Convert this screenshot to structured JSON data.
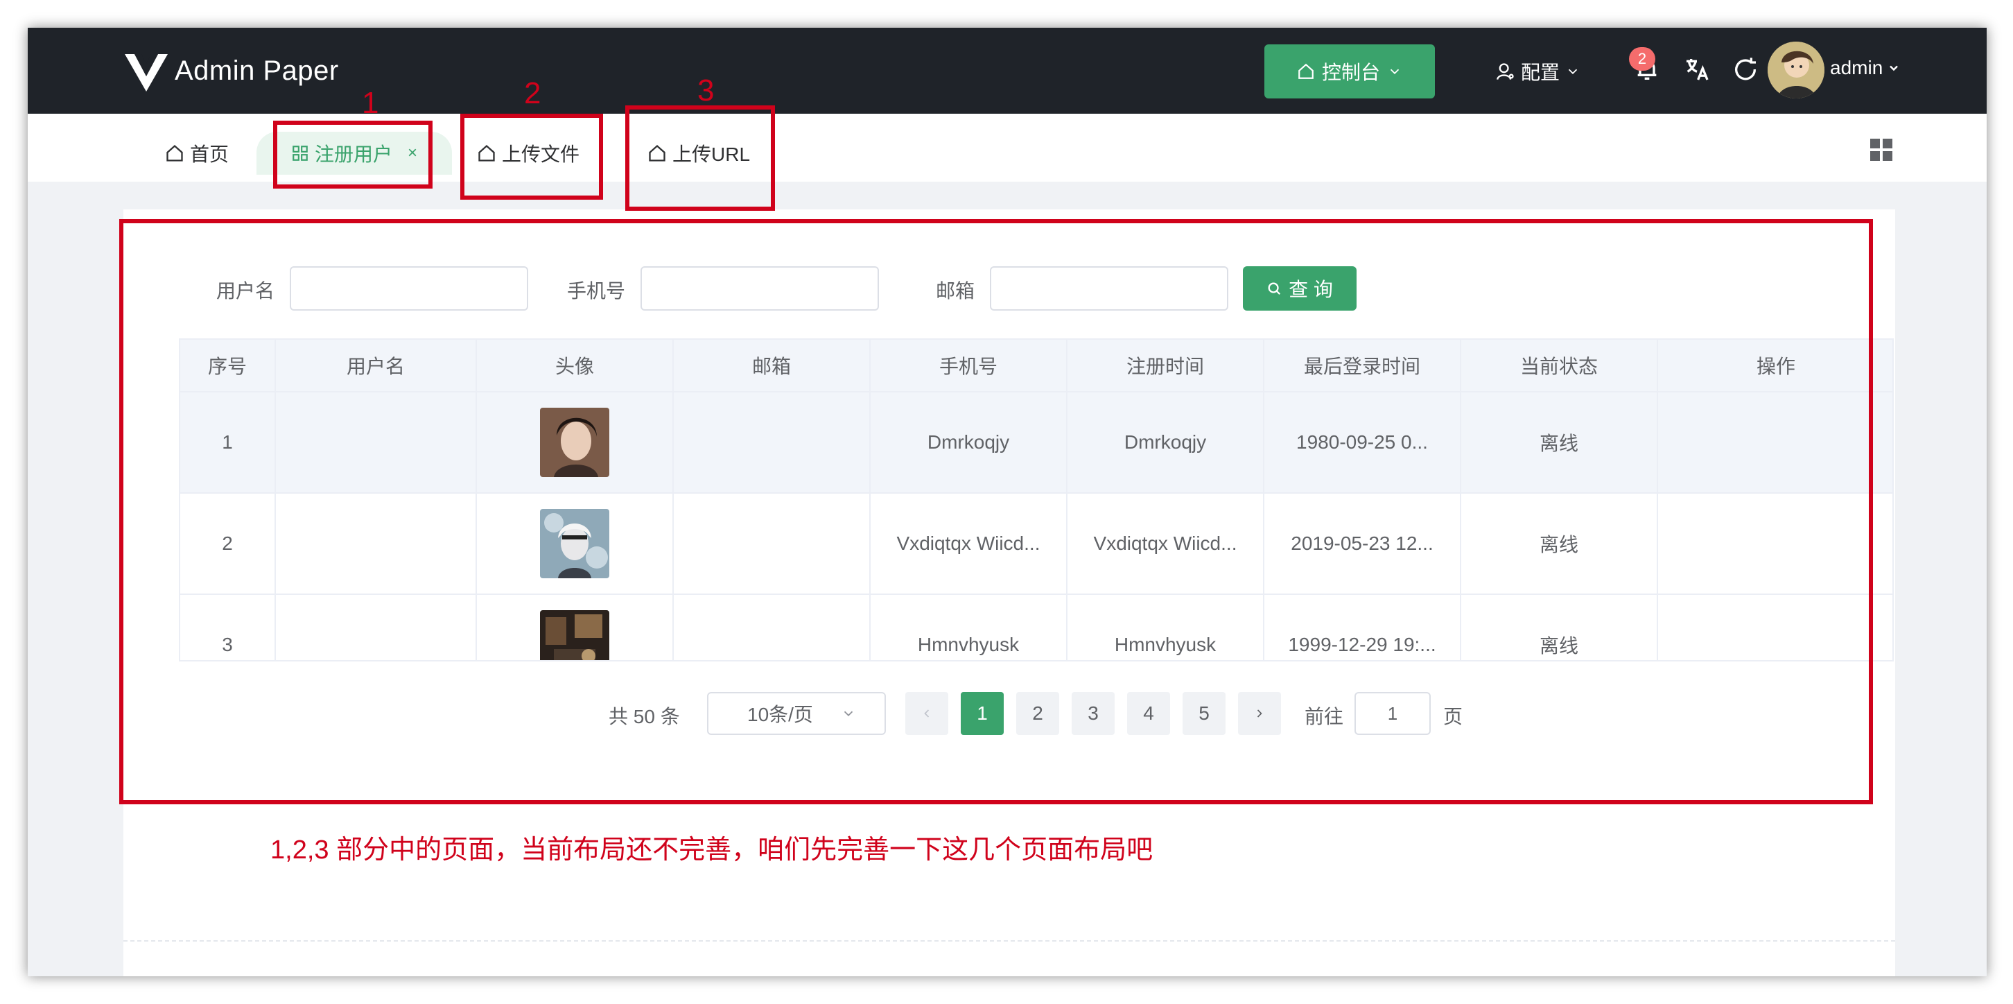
{
  "app": {
    "title": "Admin Paper"
  },
  "header": {
    "console_label": "控制台",
    "config_label": "配置",
    "notification_count": "2",
    "user_name": "admin"
  },
  "tabs": [
    {
      "label": "首页"
    },
    {
      "label": "注册用户",
      "close": "×"
    },
    {
      "label": "上传文件"
    },
    {
      "label": "上传URL"
    }
  ],
  "search": {
    "username_label": "用户名",
    "phone_label": "手机号",
    "email_label": "邮箱",
    "query_label": "查 询"
  },
  "table": {
    "columns": [
      "序号",
      "用户名",
      "头像",
      "邮箱",
      "手机号",
      "注册时间",
      "最后登录时间",
      "当前状态",
      "操作"
    ],
    "rows": [
      {
        "index": "1",
        "username": "",
        "email": "",
        "phone": "Dmrkoqjy",
        "reg_time": "Dmrkoqjy",
        "last_login": "1980-09-25 0...",
        "status": "离线",
        "action": ""
      },
      {
        "index": "2",
        "username": "",
        "email": "",
        "phone": "Vxdiqtqx Wiicd...",
        "reg_time": "Vxdiqtqx Wiicd...",
        "last_login": "2019-05-23 12...",
        "status": "离线",
        "action": ""
      },
      {
        "index": "3",
        "username": "",
        "email": "",
        "phone": "Hmnvhyusk",
        "reg_time": "Hmnvhyusk",
        "last_login": "1999-12-29 19:...",
        "status": "离线",
        "action": ""
      }
    ]
  },
  "pagination": {
    "total": "共 50 条",
    "page_size": "10条/页",
    "pages": [
      "1",
      "2",
      "3",
      "4",
      "5"
    ],
    "current": "1",
    "goto_label": "前往",
    "goto_value": "1",
    "page_suffix": "页"
  },
  "annotations": {
    "numbers": [
      "1",
      "2",
      "3"
    ],
    "note": "1,2,3 部分中的页面，当前布局还不完善，咱们先完善一下这几个页面布局吧"
  },
  "colors": {
    "header_bg": "#1f2329",
    "accent": "#3aa36c",
    "annotation_red": "#d0021b",
    "badge_red": "#f56c6c"
  }
}
